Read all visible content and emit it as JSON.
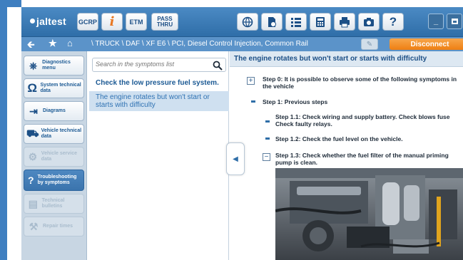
{
  "app": {
    "brand": "jaltest",
    "colors": {
      "accent": "#2f6ea8",
      "brand_orange": "#ee7f13",
      "rail": "#3f7fc0"
    }
  },
  "toolbar": {
    "gcrp_label": "GCRP",
    "info_label": "i",
    "etm_label": "ETM",
    "pass_line1": "PASS",
    "pass_line2": "THRU",
    "icons": [
      "globe-icon",
      "clean-page-icon",
      "list-icon",
      "calculator-icon",
      "print-icon",
      "camera-icon",
      "help-icon"
    ],
    "help_label": "?",
    "min_label": "_",
    "close_label": "✕"
  },
  "nav": {
    "breadcrumb": "\\ TRUCK \\ DAF \\ XF E6 \\ PCI, Diesel Control Injection, Common Rail",
    "disconnect_label": "Disconnect"
  },
  "menu": {
    "items": [
      {
        "label": "Diagnostics menu",
        "icon": "stethoscope-icon",
        "state": "normal"
      },
      {
        "label": "System technical data",
        "icon": "ohm-icon",
        "state": "normal"
      },
      {
        "label": "Diagrams",
        "icon": "diagram-icon",
        "state": "normal"
      },
      {
        "label": "Vehicle technical data",
        "icon": "truck-icon",
        "state": "normal"
      },
      {
        "label": "Vehicle service data",
        "icon": "service-icon",
        "state": "disabled"
      },
      {
        "label": "Troubleshooting by symptoms",
        "icon": "troubleshoot-icon",
        "state": "active"
      },
      {
        "label": "Technical bulletins",
        "icon": "bulletin-icon",
        "state": "disabled"
      },
      {
        "label": "Repair times",
        "icon": "repair-icon",
        "state": "disabled"
      }
    ]
  },
  "symptoms": {
    "search_placeholder": "Search in the symptoms list",
    "items": [
      {
        "text": "Check the low pressure fuel system.",
        "selected": false
      },
      {
        "text": "The engine rotates but won't start or starts with difficulty",
        "selected": true
      }
    ]
  },
  "content": {
    "title": "The engine rotates but won't start or starts with difficulty",
    "steps": [
      {
        "text": "Step 0: It is possible to observe some of the following symptoms in the vehicle",
        "marker": "+"
      },
      {
        "text": "Step 1: Previous steps",
        "marker": "-"
      },
      {
        "text": "Step 1.1: Check wiring and supply battery. Check blows fuse Check faulty relays.",
        "marker": "-"
      },
      {
        "text": "Step 1.2: Check the fuel level on the vehicle.",
        "marker": "-"
      },
      {
        "text": "Step 1.3: Check whether the fuel filter of the manual priming pump is clean.",
        "marker": "−"
      }
    ]
  }
}
